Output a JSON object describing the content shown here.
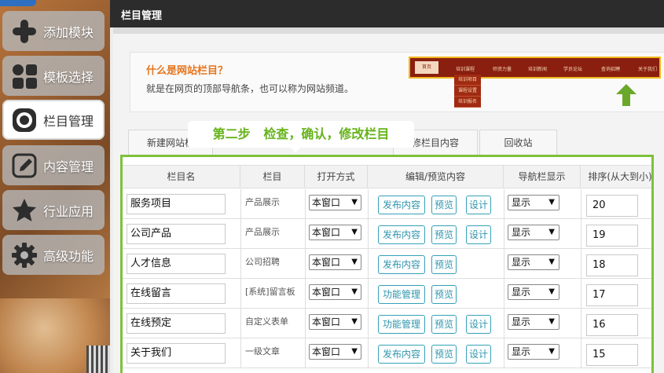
{
  "sidebar": {
    "items": [
      {
        "label": "添加模块",
        "icon": "plus-icon"
      },
      {
        "label": "模板选择",
        "icon": "grid-icon"
      },
      {
        "label": "栏目管理",
        "icon": "circle-target-icon",
        "active": true
      },
      {
        "label": "内容管理",
        "icon": "pencil-icon"
      },
      {
        "label": "行业应用",
        "icon": "star-icon"
      },
      {
        "label": "高级功能",
        "icon": "gear-icon"
      }
    ]
  },
  "panel": {
    "title": "栏目管理",
    "info": {
      "title": "什么是网站栏目？",
      "desc": "就是在网页的顶部导航条，也可以称为网站频道。"
    },
    "nav_preview": {
      "items": [
        "首页",
        "培训课程",
        "师资力量",
        "培训新闻",
        "学员论坛",
        "查询招聘",
        "关于我们"
      ],
      "sub_items": [
        "培训项目",
        "课程设置",
        "培训报名"
      ]
    },
    "tabs": [
      "新建网站栏",
      "修栏目内容",
      "回收站"
    ],
    "callout": "第二步   检查，确认，修改栏目"
  },
  "table": {
    "headers": [
      "栏目名",
      "栏目",
      "打开方式",
      "编辑/预览内容",
      "导航栏显示",
      "排序(从大到小)"
    ],
    "rows": [
      {
        "name": "服务项目",
        "type": "产品展示",
        "open": "本窗口",
        "buttons": [
          "发布内容",
          "预览",
          "设计"
        ],
        "nav": "显示",
        "order": "20"
      },
      {
        "name": "公司产品",
        "type": "产品展示",
        "open": "本窗口",
        "buttons": [
          "发布内容",
          "预览",
          "设计"
        ],
        "nav": "显示",
        "order": "19"
      },
      {
        "name": "人才信息",
        "type": "公司招聘",
        "open": "本窗口",
        "buttons": [
          "发布内容",
          "预览"
        ],
        "nav": "显示",
        "order": "18"
      },
      {
        "name": "在线留言",
        "type": "[系统]留言板",
        "open": "本窗口",
        "buttons": [
          "功能管理",
          "预览"
        ],
        "nav": "显示",
        "order": "17"
      },
      {
        "name": "在线预定",
        "type": "自定义表单",
        "open": "本窗口",
        "buttons": [
          "功能管理",
          "预览",
          "设计"
        ],
        "nav": "显示",
        "order": "16"
      },
      {
        "name": "关于我们",
        "type": "一级文章",
        "open": "本窗口",
        "buttons": [
          "发布内容",
          "预览",
          "设计"
        ],
        "nav": "显示",
        "order": "15"
      }
    ],
    "caret": "▼"
  },
  "colors": {
    "accent_green": "#7ec13b",
    "callout_green": "#66b31a",
    "button_blue": "#2f95ad",
    "info_orange": "#e6741b"
  }
}
